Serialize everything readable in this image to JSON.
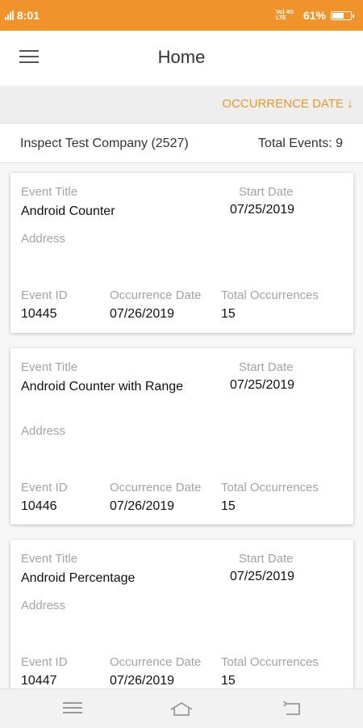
{
  "status_bar": {
    "time": "8:01",
    "network": "Vo) 4G LTE",
    "battery": "61%"
  },
  "header": {
    "title": "Home"
  },
  "sort": {
    "label": "OCCURRENCE DATE",
    "arrow": "↓"
  },
  "company": {
    "name": "Inspect Test Company (2527)",
    "total_events": "Total Events: 9"
  },
  "labels": {
    "event_title": "Event Title",
    "start_date": "Start Date",
    "address": "Address",
    "event_id": "Event ID",
    "occurrence_date": "Occurrence Date",
    "total_occurrences": "Total Occurrences"
  },
  "events": [
    {
      "title": "Android Counter",
      "start_date": "07/25/2019",
      "address": "",
      "event_id": "10445",
      "occurrence_date": "07/26/2019",
      "total_occurrences": "15"
    },
    {
      "title": "Android Counter with Range",
      "start_date": "07/25/2019",
      "address": "",
      "event_id": "10446",
      "occurrence_date": "07/26/2019",
      "total_occurrences": "15"
    },
    {
      "title": "Android Percentage",
      "start_date": "07/25/2019",
      "address": "",
      "event_id": "10447",
      "occurrence_date": "07/26/2019",
      "total_occurrences": "15"
    }
  ],
  "icons": {
    "menu": "hamburger-menu-icon",
    "sort_arrow": "arrow-down-icon",
    "nav_menu": "nav-menu-icon",
    "nav_home": "nav-home-icon",
    "nav_back": "nav-back-icon"
  },
  "colors": {
    "accent": "#f0932b",
    "label_gray": "#a3a3a3"
  }
}
